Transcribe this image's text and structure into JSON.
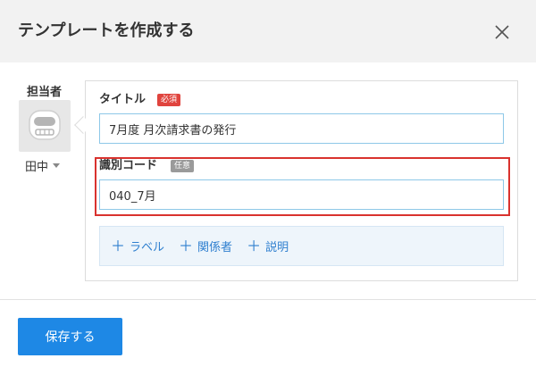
{
  "dialog": {
    "title": "テンプレートを作成する",
    "close_icon": "close-icon"
  },
  "assignee": {
    "label": "担当者",
    "name": "田中",
    "avatar_icon": "robot-avatar-icon",
    "dropdown_icon": "caret-down-icon"
  },
  "form": {
    "title_field": {
      "label": "タイトル",
      "badge": "必須",
      "value": "7月度 月次請求書の発行"
    },
    "code_field": {
      "label": "識別コード",
      "badge": "任意",
      "value": "040_7月"
    },
    "add_options": [
      {
        "label": "ラベル",
        "icon": "plus-icon"
      },
      {
        "label": "関係者",
        "icon": "plus-icon"
      },
      {
        "label": "説明",
        "icon": "plus-icon"
      }
    ]
  },
  "footer": {
    "save_label": "保存する"
  },
  "colors": {
    "header_bg": "#f2f2f2",
    "primary": "#1e88e5",
    "required_badge": "#e0443e",
    "optional_badge": "#9a9a9a",
    "highlight": "#d9322e",
    "link": "#2f7fcf"
  }
}
